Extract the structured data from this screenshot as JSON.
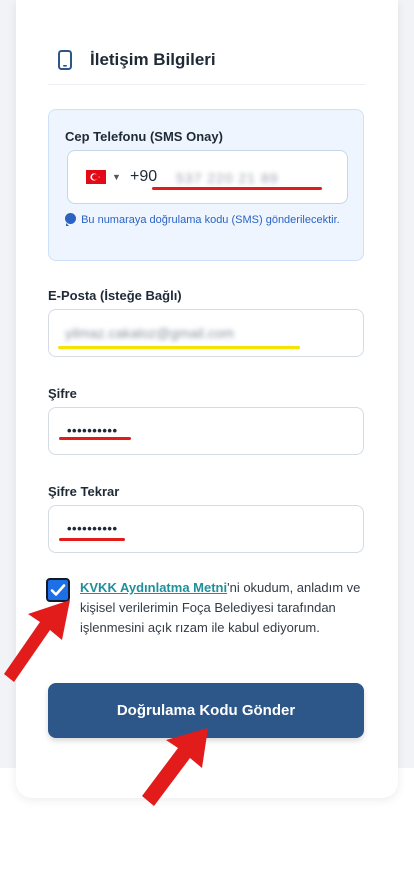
{
  "section": {
    "title": "İletişim Bilgileri",
    "icon": "smartphone-icon"
  },
  "phone": {
    "label": "Cep Telefonu (SMS Onay)",
    "country_flag": "turkey-flag-icon",
    "dial_code": "+90",
    "value": "537 220 21 89",
    "hint": "Bu numaraya doğrulama kodu (SMS) gönderilecektir."
  },
  "email": {
    "label": "E-Posta (İsteğe Bağlı)",
    "value": "yilmaz.cakaloz@gmail.com"
  },
  "password": {
    "label": "Şifre",
    "value": "••••••••••"
  },
  "password_repeat": {
    "label": "Şifre Tekrar",
    "value": "••••••••••"
  },
  "consent": {
    "checked": true,
    "link_text": "KVKK Aydınlatma Metni",
    "text": "'ni okudum, anladım ve kişisel verilerimin Foça Belediyesi tarafından işlenmesini açık rızam ile kabul ediyorum."
  },
  "submit": {
    "label": "Doğrulama Kodu Gönder"
  },
  "colors": {
    "primary_button": "#2d5689",
    "link": "#1f8f9a",
    "checkbox": "#1c6fe6",
    "annotation_red": "#e21b1b",
    "annotation_yellow": "#f5e400"
  }
}
